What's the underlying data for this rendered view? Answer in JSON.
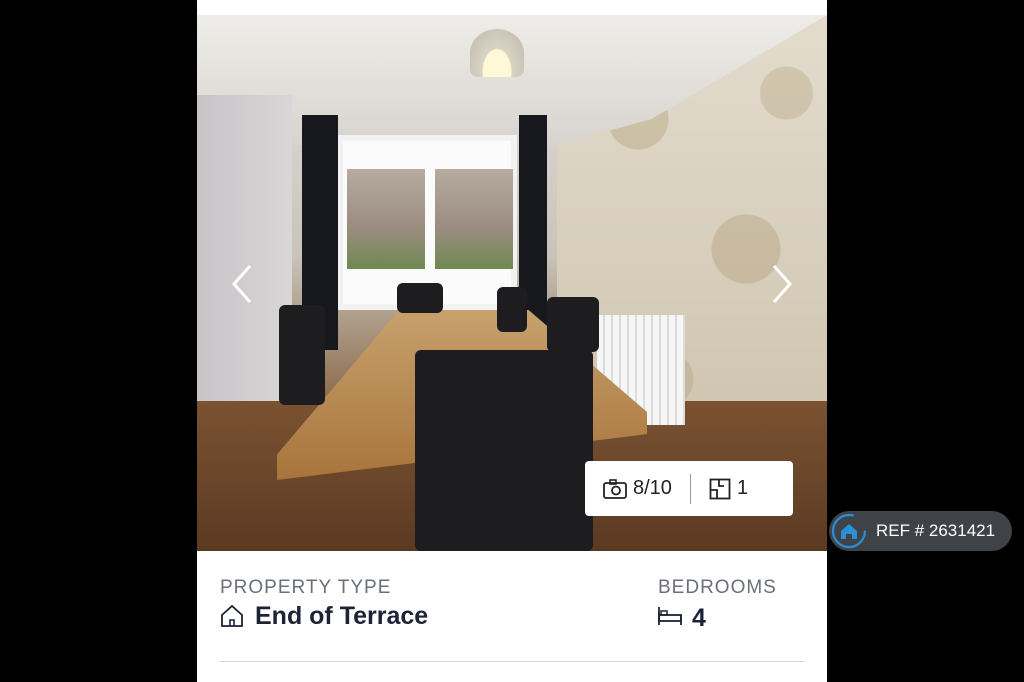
{
  "gallery": {
    "photo_counter": "8/10",
    "floorplan_count": "1",
    "prev_icon": "chevron-left-icon",
    "next_icon": "chevron-right-icon"
  },
  "ref": {
    "text": "REF # 2631421",
    "icon": "home-icon"
  },
  "details": {
    "property_type_label": "PROPERTY TYPE",
    "property_type_value": "End of Terrace",
    "bedrooms_label": "BEDROOMS",
    "bedrooms_value": "4"
  },
  "colors": {
    "accent": "#2a8fd6",
    "title_text": "#1d2236",
    "label_text": "#6b6f78"
  }
}
